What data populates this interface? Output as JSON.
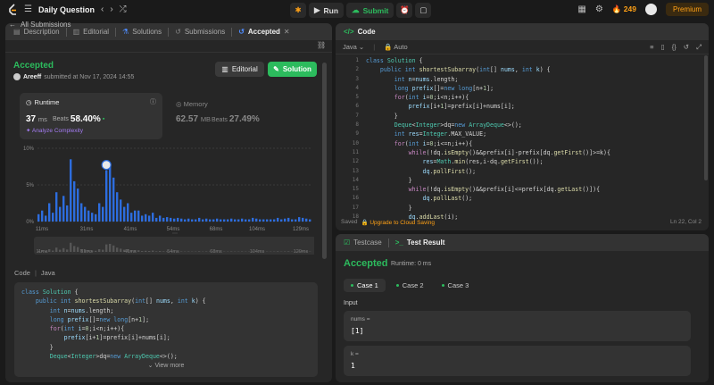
{
  "topbar": {
    "title": "Daily Question",
    "run_label": "Run",
    "submit_label": "Submit",
    "streak": "249",
    "premium_label": "Premium"
  },
  "left_tabs": [
    "Description",
    "Editorial",
    "Solutions",
    "Submissions",
    "Accepted"
  ],
  "submissions_back": "All Submissions",
  "submission": {
    "status": "Accepted",
    "user": "Areeff",
    "submitted_text": "submitted at Nov 17, 2024 14:55",
    "editorial_label": "Editorial",
    "solution_label": "Solution"
  },
  "runtime": {
    "label": "Runtime",
    "value": "37",
    "unit": "ms",
    "beats_label": "Beats",
    "beats_value": "58.40%",
    "analyze": "Analyze Complexity"
  },
  "memory": {
    "label": "Memory",
    "value": "62.57",
    "unit": "MB",
    "beats_label": "Beats",
    "beats_value": "27.49%"
  },
  "chart_data": {
    "type": "bar",
    "ylabels": [
      "10%",
      "5%",
      "0%"
    ],
    "xticks": [
      "11ms",
      "31ms",
      "41ms",
      "54ms",
      "68ms",
      "104ms",
      "129ms"
    ],
    "values": [
      1.0,
      1.5,
      0.8,
      2.5,
      1.2,
      4.0,
      2.0,
      3.5,
      2.2,
      8.5,
      5.5,
      4.5,
      2.5,
      2.0,
      1.5,
      1.2,
      1.0,
      2.5,
      2.0,
      7.0,
      7.5,
      6.0,
      4.0,
      3.0,
      2.0,
      2.5,
      1.2,
      1.5,
      1.5,
      0.8,
      1.0,
      0.8,
      1.2,
      0.5,
      0.8,
      0.5,
      0.6,
      0.5,
      0.4,
      0.5,
      0.4,
      0.3,
      0.4,
      0.3,
      0.3,
      0.5,
      0.3,
      0.4,
      0.3,
      0.3,
      0.4,
      0.3,
      0.3,
      0.3,
      0.4,
      0.3,
      0.3,
      0.4,
      0.3,
      0.3,
      0.5,
      0.4,
      0.3,
      0.3,
      0.3,
      0.3,
      0.3,
      0.5,
      0.3,
      0.4,
      0.5,
      0.3,
      0.3,
      0.6,
      0.5,
      0.4,
      0.3
    ],
    "ylim": [
      0,
      10
    ]
  },
  "code_section": {
    "label": "Code",
    "lang": "Java",
    "view_more": "View more"
  },
  "editor": {
    "tab_label": "Code",
    "lang": "Java",
    "mode": "Auto",
    "saved": "Saved",
    "upgrade": "Upgrade to Cloud Saving",
    "position": "Ln 22, Col 2"
  },
  "result": {
    "tabs": [
      "Testcase",
      "Test Result"
    ],
    "status": "Accepted",
    "runtime": "Runtime: 0 ms",
    "cases": [
      "Case 1",
      "Case 2",
      "Case 3"
    ],
    "input_label": "Input",
    "inputs": [
      {
        "name": "nums =",
        "value": "[1]"
      },
      {
        "name": "k =",
        "value": "1"
      }
    ]
  }
}
